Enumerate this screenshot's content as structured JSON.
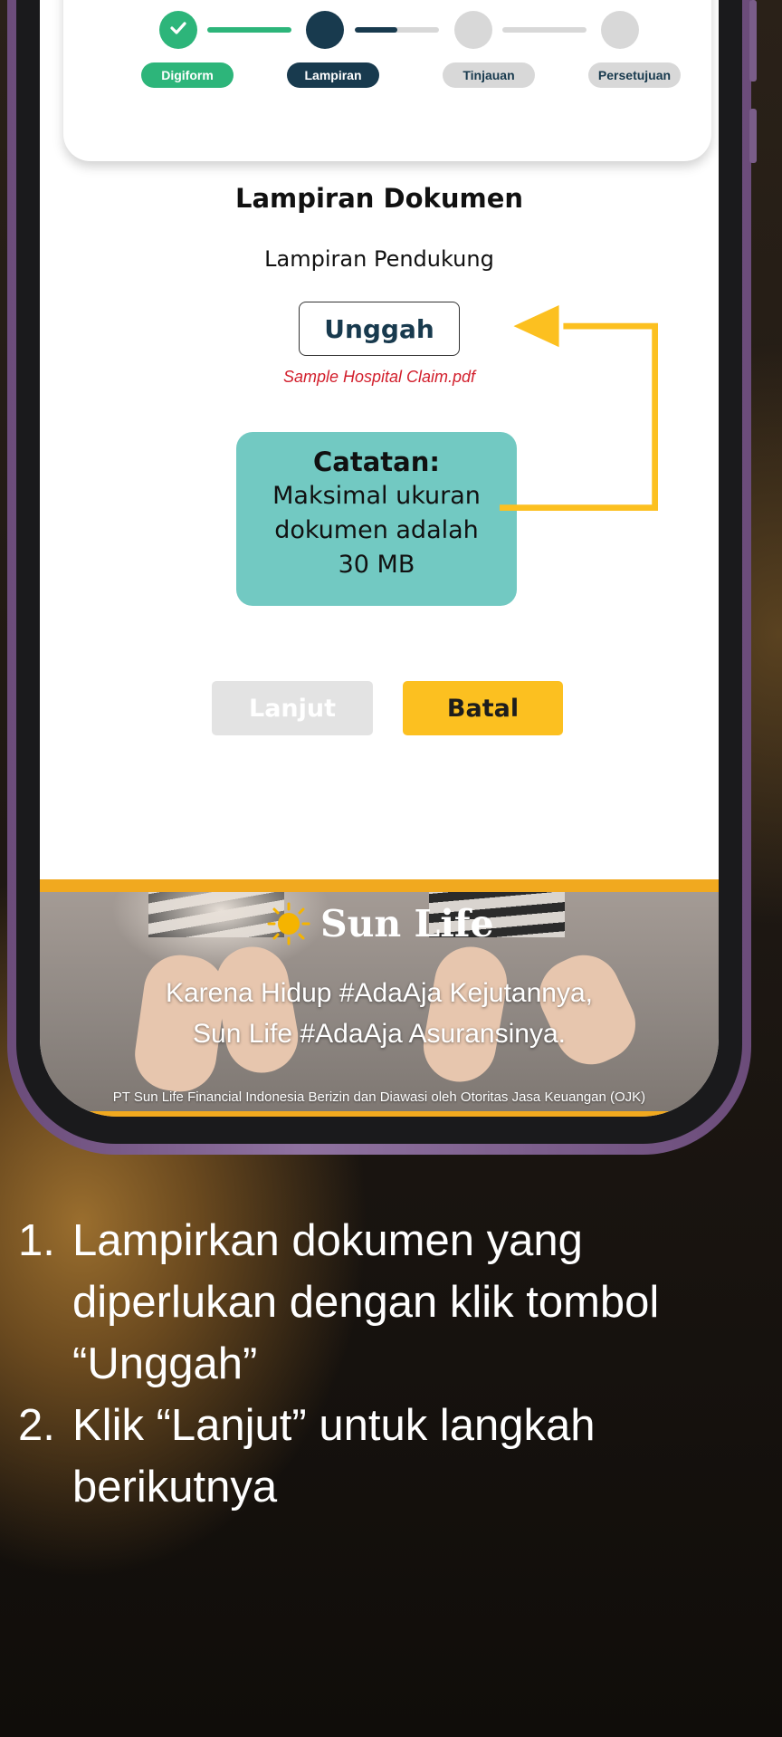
{
  "stepper": {
    "steps": [
      {
        "label": "Digiform",
        "state": "done"
      },
      {
        "label": "Lampiran",
        "state": "active"
      },
      {
        "label": "Tinjauan",
        "state": "todo"
      },
      {
        "label": "Persetujuan",
        "state": "todo"
      }
    ],
    "progress_lampiran_to_tinjauan": 0.5
  },
  "form": {
    "title": "Lampiran Dokumen",
    "subtitle": "Lampiran Pendukung",
    "upload_label": "Unggah",
    "file_name": "Sample Hospital Claim.pdf",
    "note_title": "Catatan:",
    "note_lines": [
      "Maksimal ukuran",
      "dokumen adalah",
      "30 MB"
    ],
    "next_label": "Lanjut",
    "cancel_label": "Batal"
  },
  "banner": {
    "brand": "Sun Life",
    "line1": "Karena Hidup #AdaAja Kejutannya,",
    "line2": "Sun Life #AdaAja Asuransinya.",
    "legal": "PT Sun Life Financial Indonesia Berizin dan Diawasi oleh Otoritas Jasa Keuangan (OJK)"
  },
  "instructions": [
    {
      "num": "1.",
      "text": "Lampirkan dokumen yang diperlukan dengan klik  tombol “Unggah”"
    },
    {
      "num": "2.",
      "text": "Klik “Lanjut” untuk langkah berikutnya"
    }
  ],
  "colors": {
    "done": "#2db57a",
    "active": "#183a4e",
    "todo": "#d8d8d8",
    "accent_yellow": "#fcc020",
    "note_teal": "#72c9c2",
    "file_red": "#d21f2c"
  }
}
